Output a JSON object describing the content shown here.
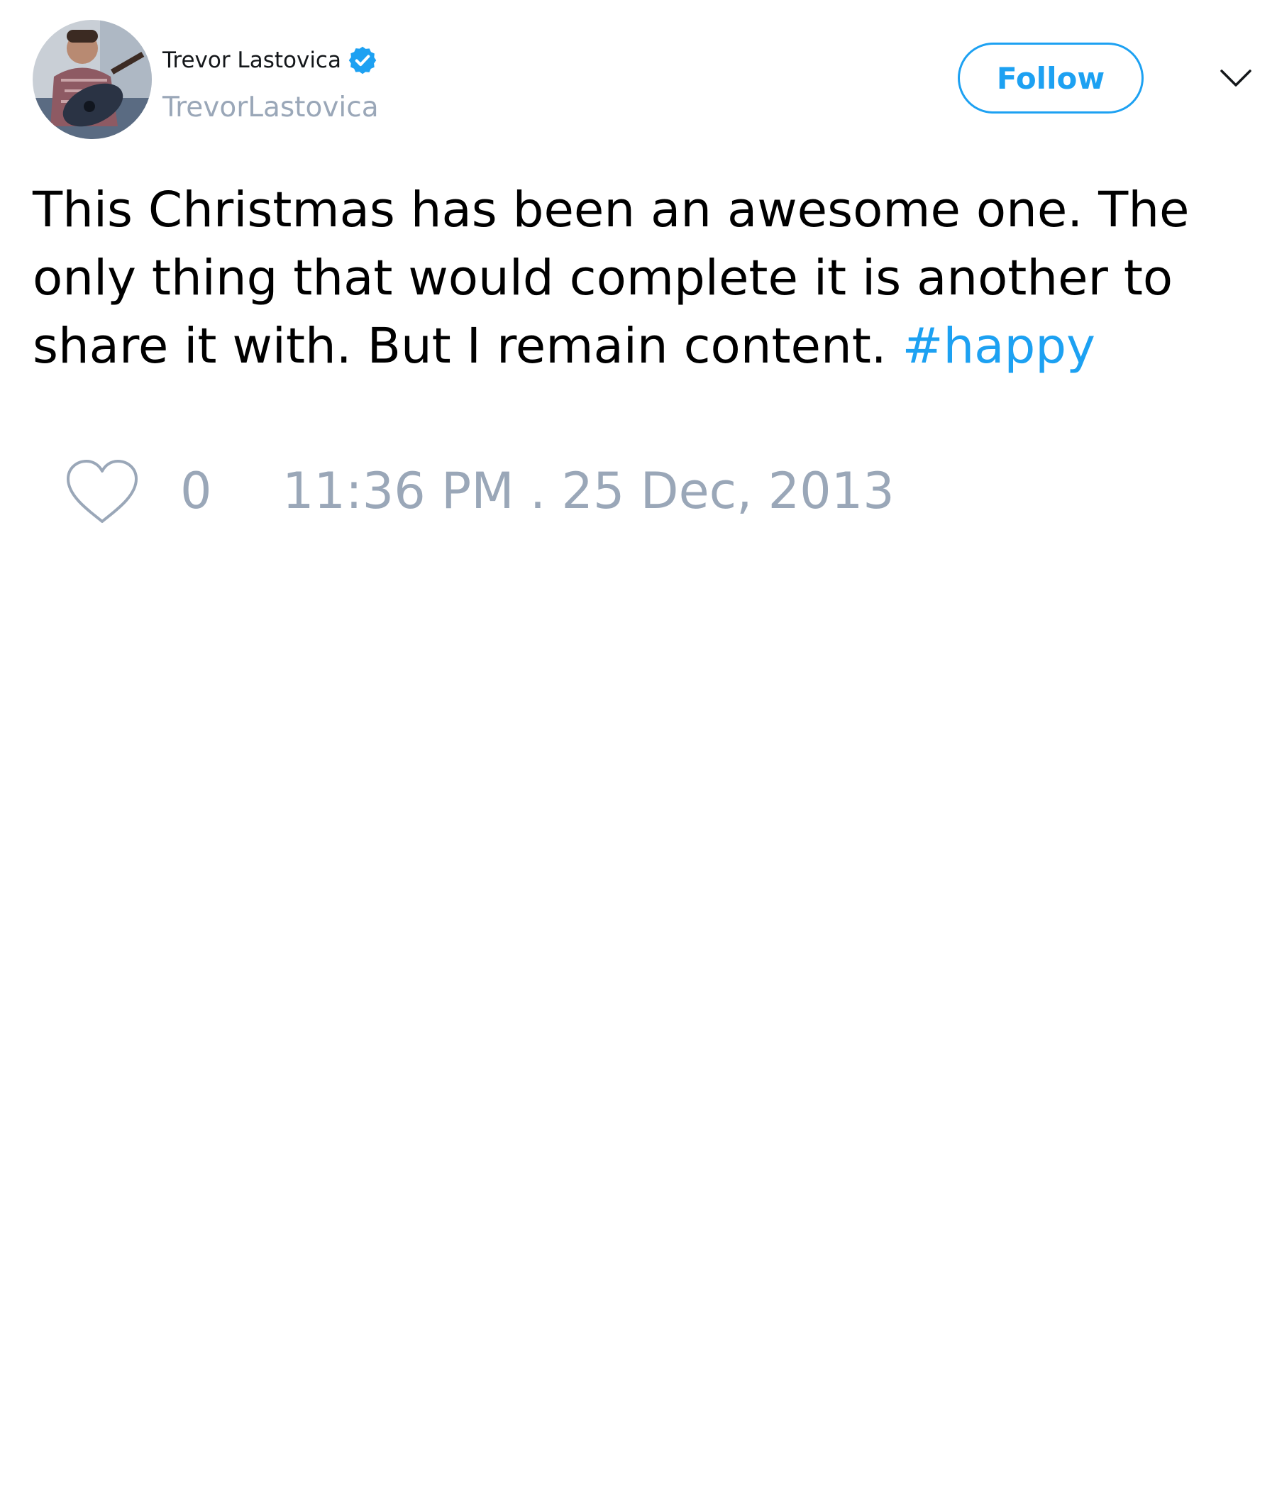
{
  "user": {
    "display_name": "Trevor Lastovica",
    "handle": "TrevorLastovica",
    "verified": true,
    "avatar_icon": "profile-photo-man-with-guitar"
  },
  "header": {
    "follow_label": "Follow",
    "menu_icon": "chevron-down-icon"
  },
  "tweet": {
    "text": "This Christmas has been an awesome one. The only thing that would complete it is another to share it with. But I remain content.",
    "hashtag": "#happy"
  },
  "footer": {
    "like_icon": "heart-icon",
    "like_count": "0",
    "timestamp": "11:36 PM . 25 Dec, 2013"
  },
  "colors": {
    "accent": "#1da1f2",
    "muted": "#9aa7b8",
    "text": "#000000"
  }
}
